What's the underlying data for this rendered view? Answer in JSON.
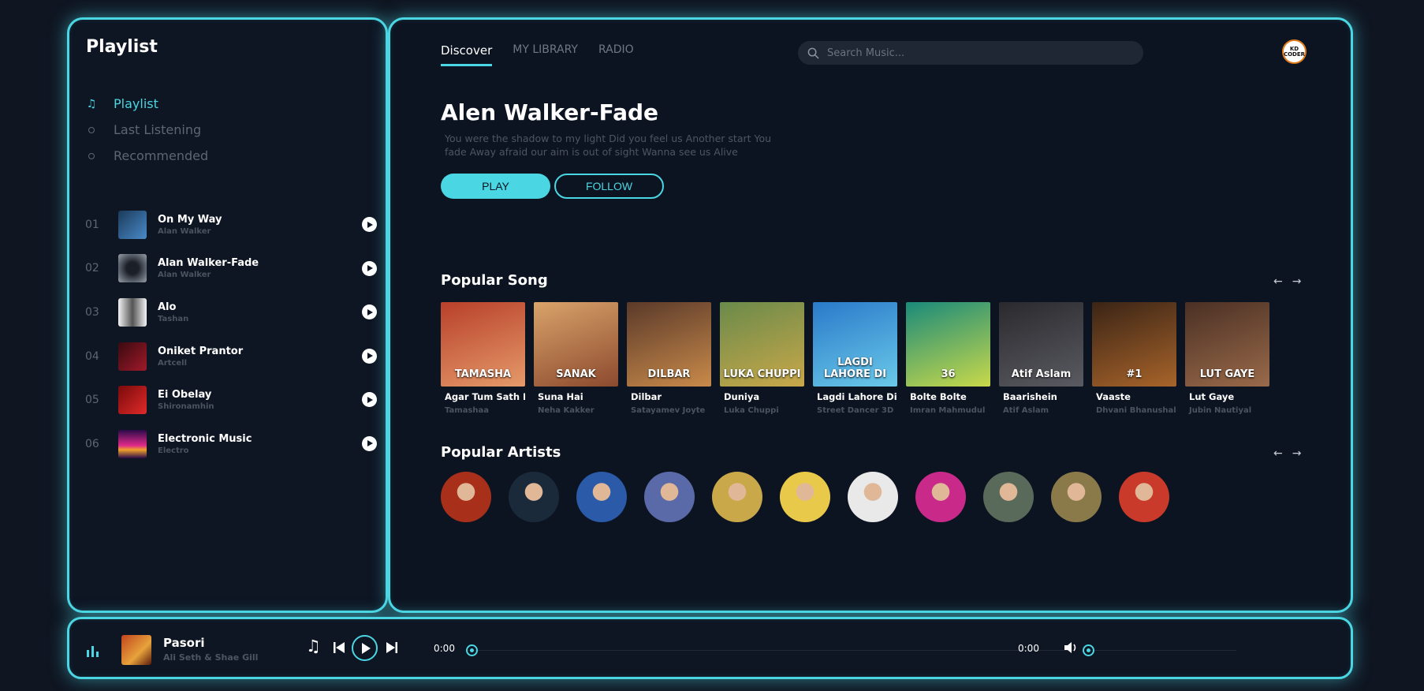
{
  "sidebar": {
    "title": "Playlist",
    "menu": [
      {
        "label": "Playlist",
        "icon": "music-note-icon",
        "active": true
      },
      {
        "label": "Last Listening",
        "icon": "dot-icon",
        "active": false
      },
      {
        "label": "Recommended",
        "icon": "dot-icon",
        "active": false
      }
    ],
    "tracks": [
      {
        "num": "01",
        "title": "On My Way",
        "artist": "Alan Walker",
        "color": "#2a5d8a"
      },
      {
        "num": "02",
        "title": "Alan Walker-Fade",
        "artist": "Alan Walker",
        "color": "#7d8591"
      },
      {
        "num": "03",
        "title": "Alo",
        "artist": "Tashan",
        "color": "#d9d9d9"
      },
      {
        "num": "04",
        "title": "Oniket Prantor",
        "artist": "Artcell",
        "color": "#7a1a24"
      },
      {
        "num": "05",
        "title": "Ei Obelay",
        "artist": "Shironamhin",
        "color": "#b21a1a"
      },
      {
        "num": "06",
        "title": "Electronic Music",
        "artist": "Electro",
        "color": "#8a2b8f"
      }
    ]
  },
  "nav": {
    "tabs": [
      {
        "label": "Discover",
        "active": true
      },
      {
        "label": "MY LIBRARY",
        "active": false
      },
      {
        "label": "RADIO",
        "active": false
      }
    ],
    "search_placeholder": "Search Music..."
  },
  "avatar_text": "KD CODER",
  "hero": {
    "title": "Alen Walker-Fade",
    "description": "You were the shadow to my light Did you feel us Another start You fade Away afraid our aim is out of sight Wanna see us Alive",
    "play_label": "PLAY",
    "follow_label": "FOLLOW"
  },
  "popular_songs": {
    "title": "Popular Song",
    "items": [
      {
        "title": "Agar Tum Sath Ho",
        "artist": "Tamashaa",
        "art_text": "TAMASHA",
        "color_a": "#b8402a",
        "color_b": "#e59a6a"
      },
      {
        "title": "Suna Hai",
        "artist": "Neha Kakker",
        "art_text": "SANAK",
        "color_a": "#d9a36a",
        "color_b": "#8c4a2e"
      },
      {
        "title": "Dilbar",
        "artist": "Satayamev Joyte",
        "art_text": "DILBAR",
        "color_a": "#5a3a2a",
        "color_b": "#c98a4a"
      },
      {
        "title": "Duniya",
        "artist": "Luka Chuppi",
        "art_text": "LUKA CHUPPI",
        "color_a": "#6a8a4a",
        "color_b": "#c9a84a"
      },
      {
        "title": "Lagdi Lahore Di",
        "artist": "Street Dancer 3D",
        "art_text": "LAGDI LAHORE DI",
        "color_a": "#2a7ac9",
        "color_b": "#6ac9e9"
      },
      {
        "title": "Bolte Bolte",
        "artist": "Imran Mahmudul",
        "art_text": "36",
        "color_a": "#1a8a7a",
        "color_b": "#c9d94a"
      },
      {
        "title": "Baarishein",
        "artist": "Atif Aslam",
        "art_text": "Atif Aslam",
        "color_a": "#2a2a2e",
        "color_b": "#5a5a62"
      },
      {
        "title": "Vaaste",
        "artist": "Dhvani Bhanushali",
        "art_text": "#1",
        "color_a": "#3a2416",
        "color_b": "#a8642a"
      },
      {
        "title": "Lut Gaye",
        "artist": "Jubin Nautiyal",
        "art_text": "LUT GAYE",
        "color_a": "#4a3024",
        "color_b": "#9a6a4a"
      }
    ]
  },
  "popular_artists": {
    "title": "Popular Artists",
    "colors": [
      "#a8301a",
      "#1a2a3a",
      "#2a5aa8",
      "#5a6aa8",
      "#c9a84a",
      "#e9c94a",
      "#e9e9e9",
      "#c92a8a",
      "#5a6a5a",
      "#8a7a4a",
      "#c93a2a"
    ]
  },
  "player": {
    "title": "Pasori",
    "artist": "Ali Seth & Shae Gill",
    "current_time": "0:00",
    "duration": "0:00",
    "progress": 0,
    "volume": 0
  },
  "colors": {
    "accent": "#4ad6e2",
    "background": "#0e1523"
  }
}
